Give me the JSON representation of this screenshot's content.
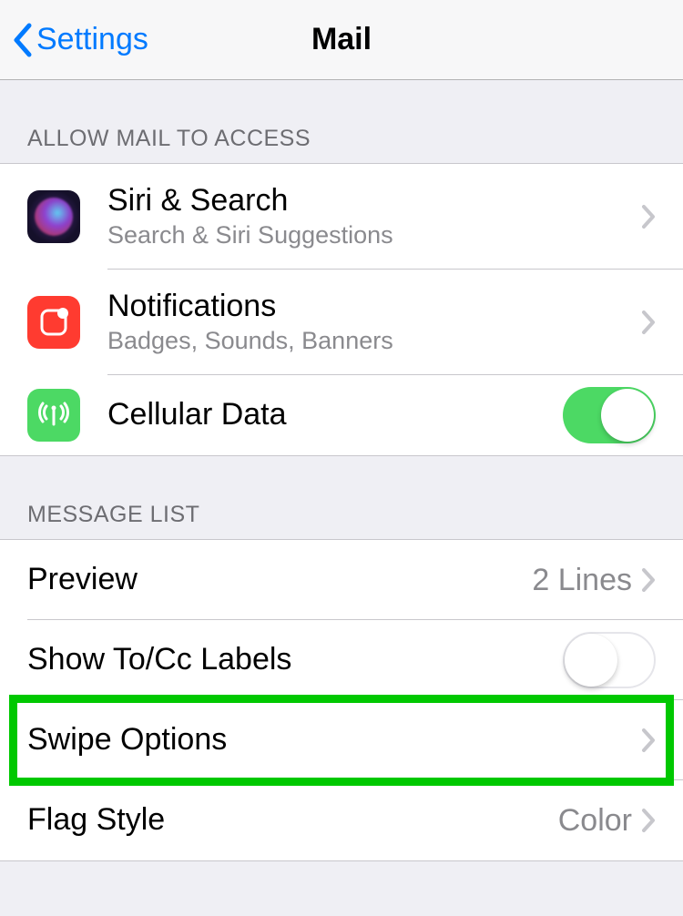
{
  "nav": {
    "back_label": "Settings",
    "title": "Mail"
  },
  "sections": {
    "allow_access": {
      "header": "Allow Mail to Access",
      "siri": {
        "title": "Siri & Search",
        "subtitle": "Search & Siri Suggestions"
      },
      "notifications": {
        "title": "Notifications",
        "subtitle": "Badges, Sounds, Banners"
      },
      "cellular": {
        "title": "Cellular Data",
        "enabled": true
      }
    },
    "message_list": {
      "header": "Message List",
      "preview": {
        "title": "Preview",
        "value": "2 Lines"
      },
      "tocc": {
        "title": "Show To/Cc Labels",
        "enabled": false
      },
      "swipe": {
        "title": "Swipe Options"
      },
      "flag": {
        "title": "Flag Style",
        "value": "Color"
      }
    }
  }
}
